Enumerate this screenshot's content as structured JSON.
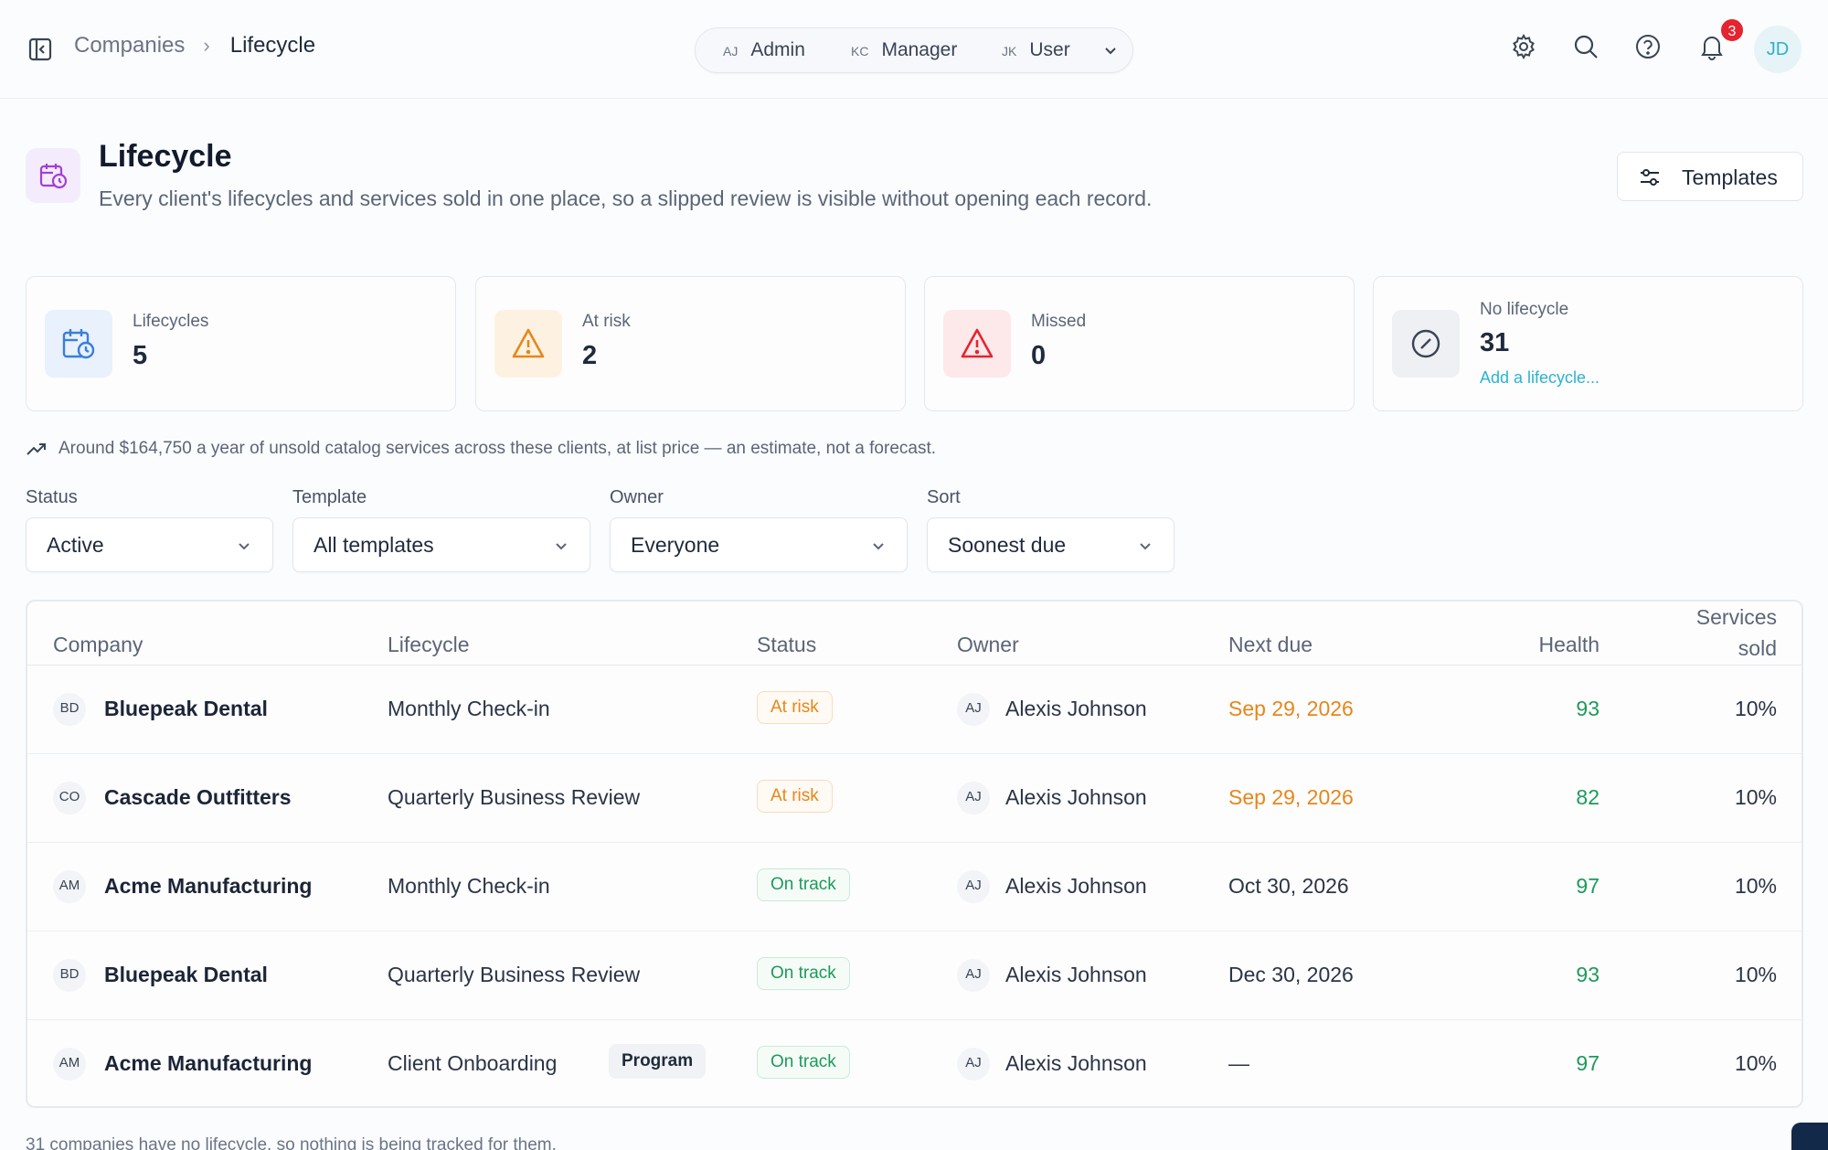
{
  "topbar": {
    "breadcrumb": [
      "Companies",
      "Lifecycle"
    ],
    "roles": [
      {
        "initials": "AJ",
        "label": "Admin"
      },
      {
        "initials": "KC",
        "label": "Manager"
      },
      {
        "initials": "JK",
        "label": "User"
      }
    ],
    "notification_count": "3",
    "user_initials": "JD"
  },
  "header": {
    "title": "Lifecycle",
    "subtitle": "Every client's lifecycles and services sold in one place, so a slipped review is visible without opening each record.",
    "templates_button": "Templates"
  },
  "stats": [
    {
      "label": "Lifecycles",
      "value": "5",
      "icon": "calendar-clock-icon",
      "color": "#3b7ddd"
    },
    {
      "label": "At risk",
      "value": "2",
      "icon": "warning-icon",
      "color": "#e7861a"
    },
    {
      "label": "Missed",
      "value": "0",
      "icon": "alert-icon",
      "color": "#e5242f"
    },
    {
      "label": "No lifecycle",
      "value": "31",
      "icon": "slash-circle-icon",
      "link": "Add a lifecycle..."
    }
  ],
  "estimate_note": "Around $164,750 a year of unsold catalog services across these clients, at list price — an estimate, not a forecast.",
  "filters": [
    {
      "label": "Status",
      "value": "Active"
    },
    {
      "label": "Template",
      "value": "All templates"
    },
    {
      "label": "Owner",
      "value": "Everyone"
    },
    {
      "label": "Sort",
      "value": "Soonest due"
    }
  ],
  "table": {
    "columns": [
      "Company",
      "Lifecycle",
      "Status",
      "Owner",
      "Next due",
      "Health",
      "Services sold"
    ],
    "rows": [
      {
        "initials": "BD",
        "company": "Bluepeak Dental",
        "lifecycle": "Monthly Check-in",
        "tag": "",
        "status": "At risk",
        "owner_initials": "AJ",
        "owner": "Alexis Johnson",
        "next_due": "Sep 29, 2026",
        "health": "93",
        "sold": "10%"
      },
      {
        "initials": "CO",
        "company": "Cascade Outfitters",
        "lifecycle": "Quarterly Business Review",
        "tag": "",
        "status": "At risk",
        "owner_initials": "AJ",
        "owner": "Alexis Johnson",
        "next_due": "Sep 29, 2026",
        "health": "82",
        "sold": "10%"
      },
      {
        "initials": "AM",
        "company": "Acme Manufacturing",
        "lifecycle": "Monthly Check-in",
        "tag": "",
        "status": "On track",
        "owner_initials": "AJ",
        "owner": "Alexis Johnson",
        "next_due": "Oct 30, 2026",
        "health": "97",
        "sold": "10%"
      },
      {
        "initials": "BD",
        "company": "Bluepeak Dental",
        "lifecycle": "Quarterly Business Review",
        "tag": "",
        "status": "On track",
        "owner_initials": "AJ",
        "owner": "Alexis Johnson",
        "next_due": "Dec 30, 2026",
        "health": "93",
        "sold": "10%"
      },
      {
        "initials": "AM",
        "company": "Acme Manufacturing",
        "lifecycle": "Client Onboarding",
        "tag": "Program",
        "status": "On track",
        "owner_initials": "AJ",
        "owner": "Alexis Johnson",
        "next_due": "—",
        "health": "97",
        "sold": "10%"
      }
    ]
  },
  "footer_note": "31 companies have no lifecycle, so nothing is being tracked for them."
}
